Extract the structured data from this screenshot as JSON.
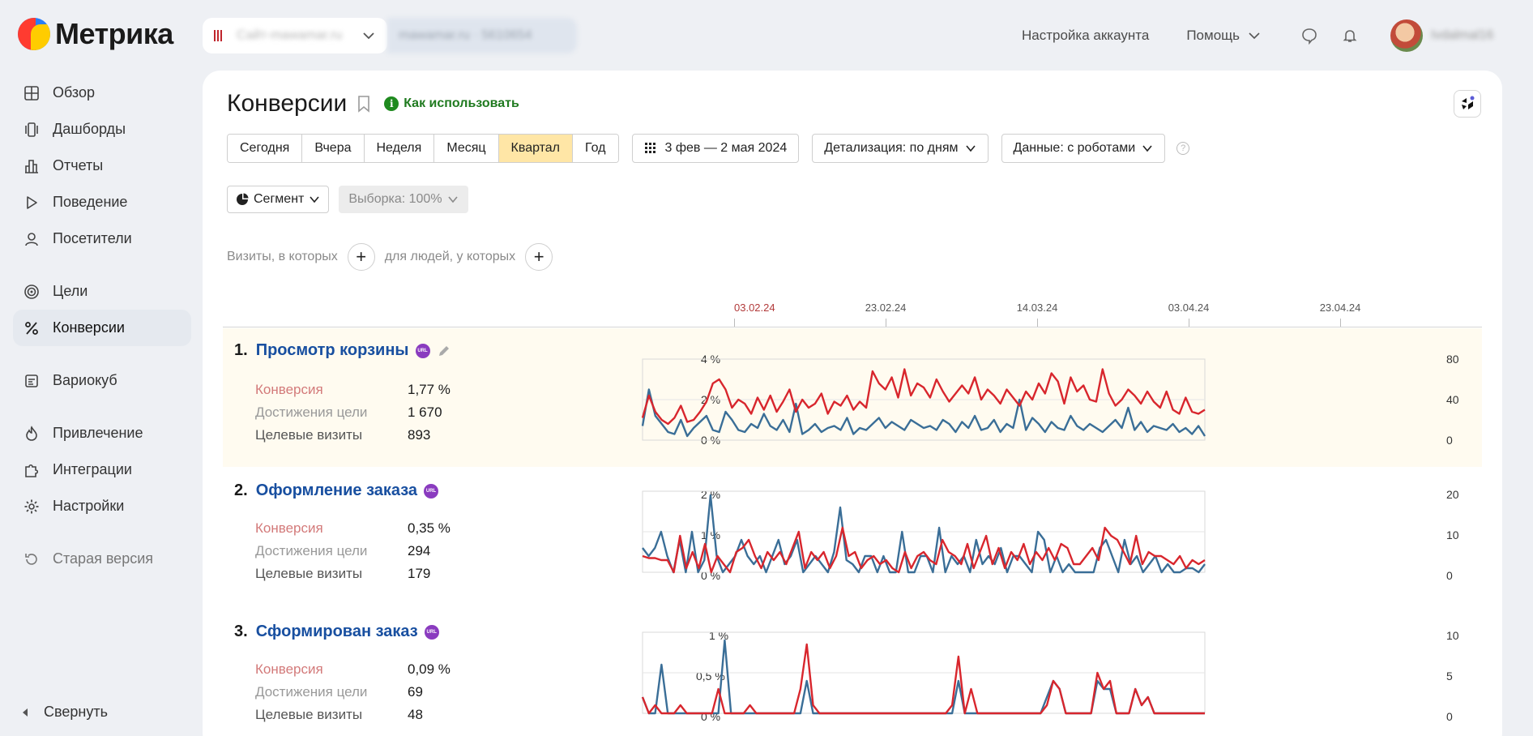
{
  "app": {
    "logo_text": "Метрика",
    "counter_site": "Сайт-mawamar.ru",
    "counter_meta": "mawamar.ru · 5610654"
  },
  "header": {
    "account_settings": "Настройка аккаунта",
    "help": "Помощь",
    "username": "Ivdalmal16"
  },
  "sidebar": {
    "items": [
      {
        "label": "Обзор",
        "icon": "grid-icon"
      },
      {
        "label": "Дашборды",
        "icon": "dashboards-icon"
      },
      {
        "label": "Отчеты",
        "icon": "bar-chart-icon"
      },
      {
        "label": "Поведение",
        "icon": "play-icon"
      },
      {
        "label": "Посетители",
        "icon": "user-icon"
      },
      {
        "label": "Цели",
        "icon": "target-icon"
      },
      {
        "label": "Конверсии",
        "icon": "percent-icon"
      },
      {
        "label": "Вариокуб",
        "icon": "cube-icon"
      },
      {
        "label": "Привлечение",
        "icon": "flame-icon"
      },
      {
        "label": "Интеграции",
        "icon": "puzzle-icon"
      },
      {
        "label": "Настройки",
        "icon": "gear-icon"
      },
      {
        "label": "Старая версия",
        "icon": "history-icon"
      }
    ],
    "active": "Конверсии",
    "collapse_label": "Свернуть"
  },
  "page": {
    "title": "Конверсии",
    "how_to_use": "Как использовать",
    "periods": [
      "Сегодня",
      "Вчера",
      "Неделя",
      "Месяц",
      "Квартал",
      "Год"
    ],
    "selected_period": "Квартал",
    "date_range": "3 фев — 2 мая 2024",
    "detail": "Детализация: по дням",
    "data_mode": "Данные: с роботами",
    "segment": "Сегмент",
    "sample": "Выборка: 100%",
    "visits_where": "Визиты, в которых",
    "people_where": "для людей, у которых"
  },
  "timeline": {
    "dates": [
      "03.02.24",
      "23.02.24",
      "14.03.24",
      "03.04.24",
      "23.04.24"
    ]
  },
  "labels": {
    "conversion": "Конверсия",
    "achievements": "Достижения цели",
    "target_visits": "Целевые визиты"
  },
  "colors": {
    "conversion_line": "#d8262d",
    "visits_line": "#3a6e97",
    "selected_period": "#ffe6a6",
    "link": "#184fa0"
  },
  "goals": [
    {
      "num": "1.",
      "name": "Просмотр корзины",
      "conversion": "1,77 %",
      "achievements": "1 670",
      "target_visits": "893",
      "left_ticks": [
        "4 %",
        "2 %",
        "0 %"
      ],
      "right_ticks": [
        "80",
        "40",
        "0"
      ]
    },
    {
      "num": "2.",
      "name": "Оформление заказа",
      "conversion": "0,35 %",
      "achievements": "294",
      "target_visits": "179",
      "left_ticks": [
        "2 %",
        "1 %",
        "0 %"
      ],
      "right_ticks": [
        "20",
        "10",
        "0"
      ]
    },
    {
      "num": "3.",
      "name": "Сформирован заказ",
      "conversion": "0,09 %",
      "achievements": "69",
      "target_visits": "48",
      "left_ticks": [
        "1 %",
        "0,5 %",
        "0 %"
      ],
      "right_ticks": [
        "10",
        "5",
        "0"
      ]
    }
  ],
  "chart_data": [
    {
      "type": "line",
      "title": "Просмотр корзины",
      "ylim_left": [
        0,
        4
      ],
      "ylim_right": [
        0,
        80
      ],
      "series": [
        {
          "name": "Конверсия",
          "axis": "left",
          "values": [
            1.1,
            2.2,
            1.4,
            1.0,
            0.8,
            1.1,
            1.7,
            0.9,
            1.0,
            1.4,
            1.9,
            2.8,
            3.0,
            2.5,
            1.6,
            2.0,
            1.8,
            1.3,
            2.1,
            1.5,
            2.2,
            1.4,
            1.9,
            2.5,
            1.4,
            2.0,
            1.6,
            1.8,
            2.3,
            1.3,
            1.9,
            1.7,
            2.2,
            1.5,
            1.9,
            1.6,
            3.4,
            2.8,
            2.5,
            3.1,
            2.1,
            3.5,
            2.2,
            2.8,
            2.6,
            2.1,
            3.0,
            2.4,
            1.9,
            2.3,
            2.7,
            2.3,
            3.1,
            2.0,
            2.5,
            2.2,
            1.8,
            2.5,
            2.1,
            1.7,
            2.4,
            2.0,
            2.8,
            2.3,
            3.3,
            2.9,
            1.8,
            3.1,
            2.4,
            2.7,
            2.0,
            1.9,
            3.5,
            2.3,
            1.7,
            2.0,
            2.5,
            2.2,
            1.8,
            2.4,
            1.9,
            1.6,
            2.4,
            1.5,
            1.3,
            2.1,
            1.4,
            1.3,
            1.5
          ]
        },
        {
          "name": "Целевые визиты",
          "axis": "right",
          "values": [
            14,
            50,
            24,
            16,
            8,
            6,
            20,
            4,
            12,
            18,
            24,
            10,
            8,
            28,
            20,
            10,
            8,
            16,
            12,
            26,
            14,
            10,
            20,
            8,
            36,
            6,
            10,
            16,
            8,
            12,
            14,
            10,
            22,
            6,
            12,
            10,
            16,
            22,
            12,
            18,
            14,
            10,
            20,
            16,
            12,
            14,
            10,
            20,
            16,
            8,
            18,
            12,
            24,
            10,
            12,
            20,
            8,
            16,
            12,
            40,
            10,
            22,
            16,
            8,
            18,
            12,
            10,
            24,
            14,
            10,
            16,
            12,
            8,
            14,
            20,
            12,
            32,
            10,
            18,
            8,
            14,
            12,
            10,
            16,
            8,
            12,
            6,
            14,
            4
          ]
        }
      ]
    },
    {
      "type": "line",
      "title": "Оформление заказа",
      "ylim_left": [
        0,
        2
      ],
      "ylim_right": [
        0,
        20
      ],
      "series": [
        {
          "name": "Конверсия",
          "axis": "left",
          "values": [
            0.4,
            0.35,
            0.35,
            0.3,
            0.3,
            0.0,
            0.9,
            0.1,
            0.5,
            0.1,
            0.7,
            0.0,
            0.4,
            0.2,
            0.0,
            0.5,
            0.6,
            0.8,
            0.4,
            0.1,
            0.5,
            0.3,
            0.5,
            0.2,
            0.6,
            1.0,
            0.1,
            0.5,
            0.3,
            0.5,
            0.1,
            0.4,
            1.1,
            0.4,
            0.5,
            0.1,
            0.3,
            0.4,
            0.2,
            0.3,
            0.1,
            0.0,
            0.5,
            0.1,
            0.4,
            0.5,
            0.3,
            0.2,
            0.8,
            0.5,
            0.4,
            0.2,
            0.7,
            0.1,
            0.5,
            0.9,
            0.2,
            0.6,
            0.1,
            0.5,
            0.3,
            0.7,
            0.2,
            0.5,
            0.3,
            0.6,
            0.3,
            0.7,
            0.6,
            0.2,
            0.2,
            0.4,
            0.6,
            0.3,
            1.1,
            0.9,
            0.8,
            0.5,
            0.2,
            0.9,
            0.2,
            0.5,
            0.4,
            0.4,
            0.3,
            0.2,
            0.4,
            0.1,
            0.3,
            0.2,
            0.3
          ]
        },
        {
          "name": "Целевые визиты",
          "axis": "right",
          "values": [
            6,
            4,
            6,
            10,
            4,
            0,
            8,
            0,
            10,
            0,
            3,
            19,
            4,
            0,
            2,
            4,
            8,
            4,
            2,
            4,
            0,
            4,
            8,
            2,
            4,
            8,
            0,
            2,
            4,
            2,
            0,
            5,
            16,
            3,
            2,
            0,
            4,
            4,
            0,
            4,
            0,
            0,
            10,
            0,
            0,
            4,
            4,
            0,
            11,
            0,
            4,
            2,
            4,
            0,
            8,
            2,
            4,
            2,
            6,
            0,
            4,
            4,
            2,
            0,
            10,
            8,
            0,
            4,
            0,
            2,
            0,
            0,
            0,
            0,
            6,
            8,
            4,
            0,
            8,
            2,
            4,
            0,
            2,
            4,
            0,
            2,
            0,
            0,
            1,
            1,
            0,
            2
          ]
        }
      ]
    },
    {
      "type": "line",
      "title": "Сформирован заказ",
      "ylim_left": [
        0,
        1
      ],
      "ylim_right": [
        0,
        10
      ],
      "series": [
        {
          "name": "Конверсия",
          "axis": "left",
          "values": [
            0.2,
            0.0,
            0.1,
            0.0,
            0.0,
            0.0,
            0.1,
            0.0,
            0.0,
            0.0,
            0.0,
            0.0,
            0.3,
            0.0,
            0.0,
            0.0,
            0.0,
            0.1,
            0.0,
            0.0,
            0.0,
            0.0,
            0.0,
            0.0,
            0.0,
            0.3,
            0.85,
            0.1,
            0.0,
            0.0,
            0.0,
            0.0,
            0.0,
            0.0,
            0.0,
            0.0,
            0.0,
            0.0,
            0.0,
            0.0,
            0.0,
            0.0,
            0.0,
            0.0,
            0.0,
            0.0,
            0.0,
            0.0,
            0.0,
            0.1,
            0.7,
            0.0,
            0.3,
            0.0,
            0.0,
            0.0,
            0.0,
            0.0,
            0.0,
            0.0,
            0.0,
            0.0,
            0.0,
            0.0,
            0.1,
            0.4,
            0.3,
            0.0,
            0.0,
            0.0,
            0.0,
            0.0,
            0.5,
            0.3,
            0.4,
            0.0,
            0.0,
            0.0,
            0.3,
            0.1,
            0.2,
            0.0,
            0.0,
            0.0,
            0.0,
            0.0,
            0.0,
            0.0,
            0.0,
            0.0
          ]
        },
        {
          "name": "Целевые визиты",
          "axis": "right",
          "values": [
            2,
            0,
            0,
            6,
            0,
            0,
            0,
            0,
            0,
            0,
            0,
            0,
            0,
            9,
            0,
            0,
            0,
            0,
            0,
            0,
            0,
            0,
            0,
            0,
            0,
            0,
            4,
            0,
            0,
            0,
            0,
            0,
            0,
            0,
            0,
            0,
            0,
            0,
            0,
            0,
            0,
            0,
            0,
            0,
            0,
            0,
            0,
            0,
            0,
            0,
            4,
            0,
            0,
            0,
            0,
            0,
            0,
            0,
            0,
            0,
            0,
            0,
            0,
            0,
            2,
            4,
            3,
            0,
            0,
            0,
            0,
            0,
            4,
            3,
            3,
            0,
            0,
            0,
            3,
            1,
            2,
            0,
            0,
            0,
            0,
            0,
            0,
            0,
            0,
            0
          ]
        }
      ]
    }
  ]
}
